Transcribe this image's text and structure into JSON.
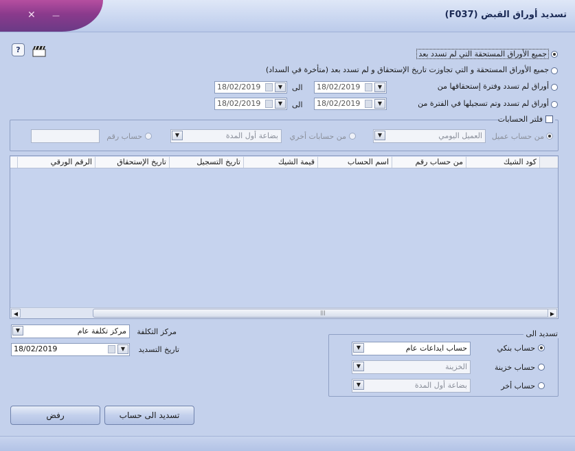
{
  "window": {
    "title": "تسديد أوراق القبض  (F037)",
    "close_glyph": "✕",
    "minimize_glyph": "—"
  },
  "toolbar": {
    "help_icon": "help-icon",
    "clapper_icon": "clapperboard-icon"
  },
  "options": [
    {
      "label": "جميع الأوراق المستحقة التي لم تسدد بعد",
      "selected": true
    },
    {
      "label": "جميع الأوراق المستحقة و التي تجاوزت تاريخ الإستحقاق و لم تسدد بعد (متأخرة في السداد)",
      "selected": false
    },
    {
      "label": "أوراق لم تسدد وفترة إستحقاقها من",
      "selected": false
    },
    {
      "label": "أوراق لم تسدد وتم تسجيلها في الفترة من",
      "selected": false
    }
  ],
  "ranges": {
    "to_word": "الى",
    "row1": {
      "from": "18/02/2019",
      "to": "18/02/2019"
    },
    "row2": {
      "from": "18/02/2019",
      "to": "18/02/2019"
    }
  },
  "filter": {
    "label": "فلتر الحسابات",
    "from_customer": "من حساب عميل",
    "customer_value": "العميل اليومي",
    "other_accounts": "من حسابات أخري",
    "other_value": "بضاعة أول المدة",
    "account_no": "حساب رقم",
    "account_no_value": ""
  },
  "grid": {
    "columns": [
      "كود الشيك",
      "من حساب رقم",
      "اسم الحساب",
      "قيمة الشيك",
      "تاريخ التسجيل",
      "تاريخ الإستحقاق",
      "الرقم الورقي"
    ],
    "rows": [],
    "scroll_left": "◀",
    "scroll_right": "▶",
    "scroll_thumb": "|||"
  },
  "cost_center": {
    "label": "مركز التكلفة",
    "value": "مركز تكلفة عام"
  },
  "payment_date": {
    "label": "تاريخ التسديد",
    "value": "18/02/2019"
  },
  "settle_to": {
    "legend": "تسديد الى",
    "bank_label": "حساب بنكي",
    "bank_value": "حساب ايداعات عام",
    "cash_label": "حساب خزينة",
    "cash_value": "الخزينة",
    "other_label": "حساب أخر",
    "other_value": "بضاعة أول المدة"
  },
  "buttons": {
    "settle": "تسديد الى حساب",
    "reject": "رفض"
  },
  "glyphs": {
    "dropdown": "▼"
  },
  "colors": {
    "window_bg": "#c4d1ec",
    "accent_tab": "#8a3a8c"
  }
}
